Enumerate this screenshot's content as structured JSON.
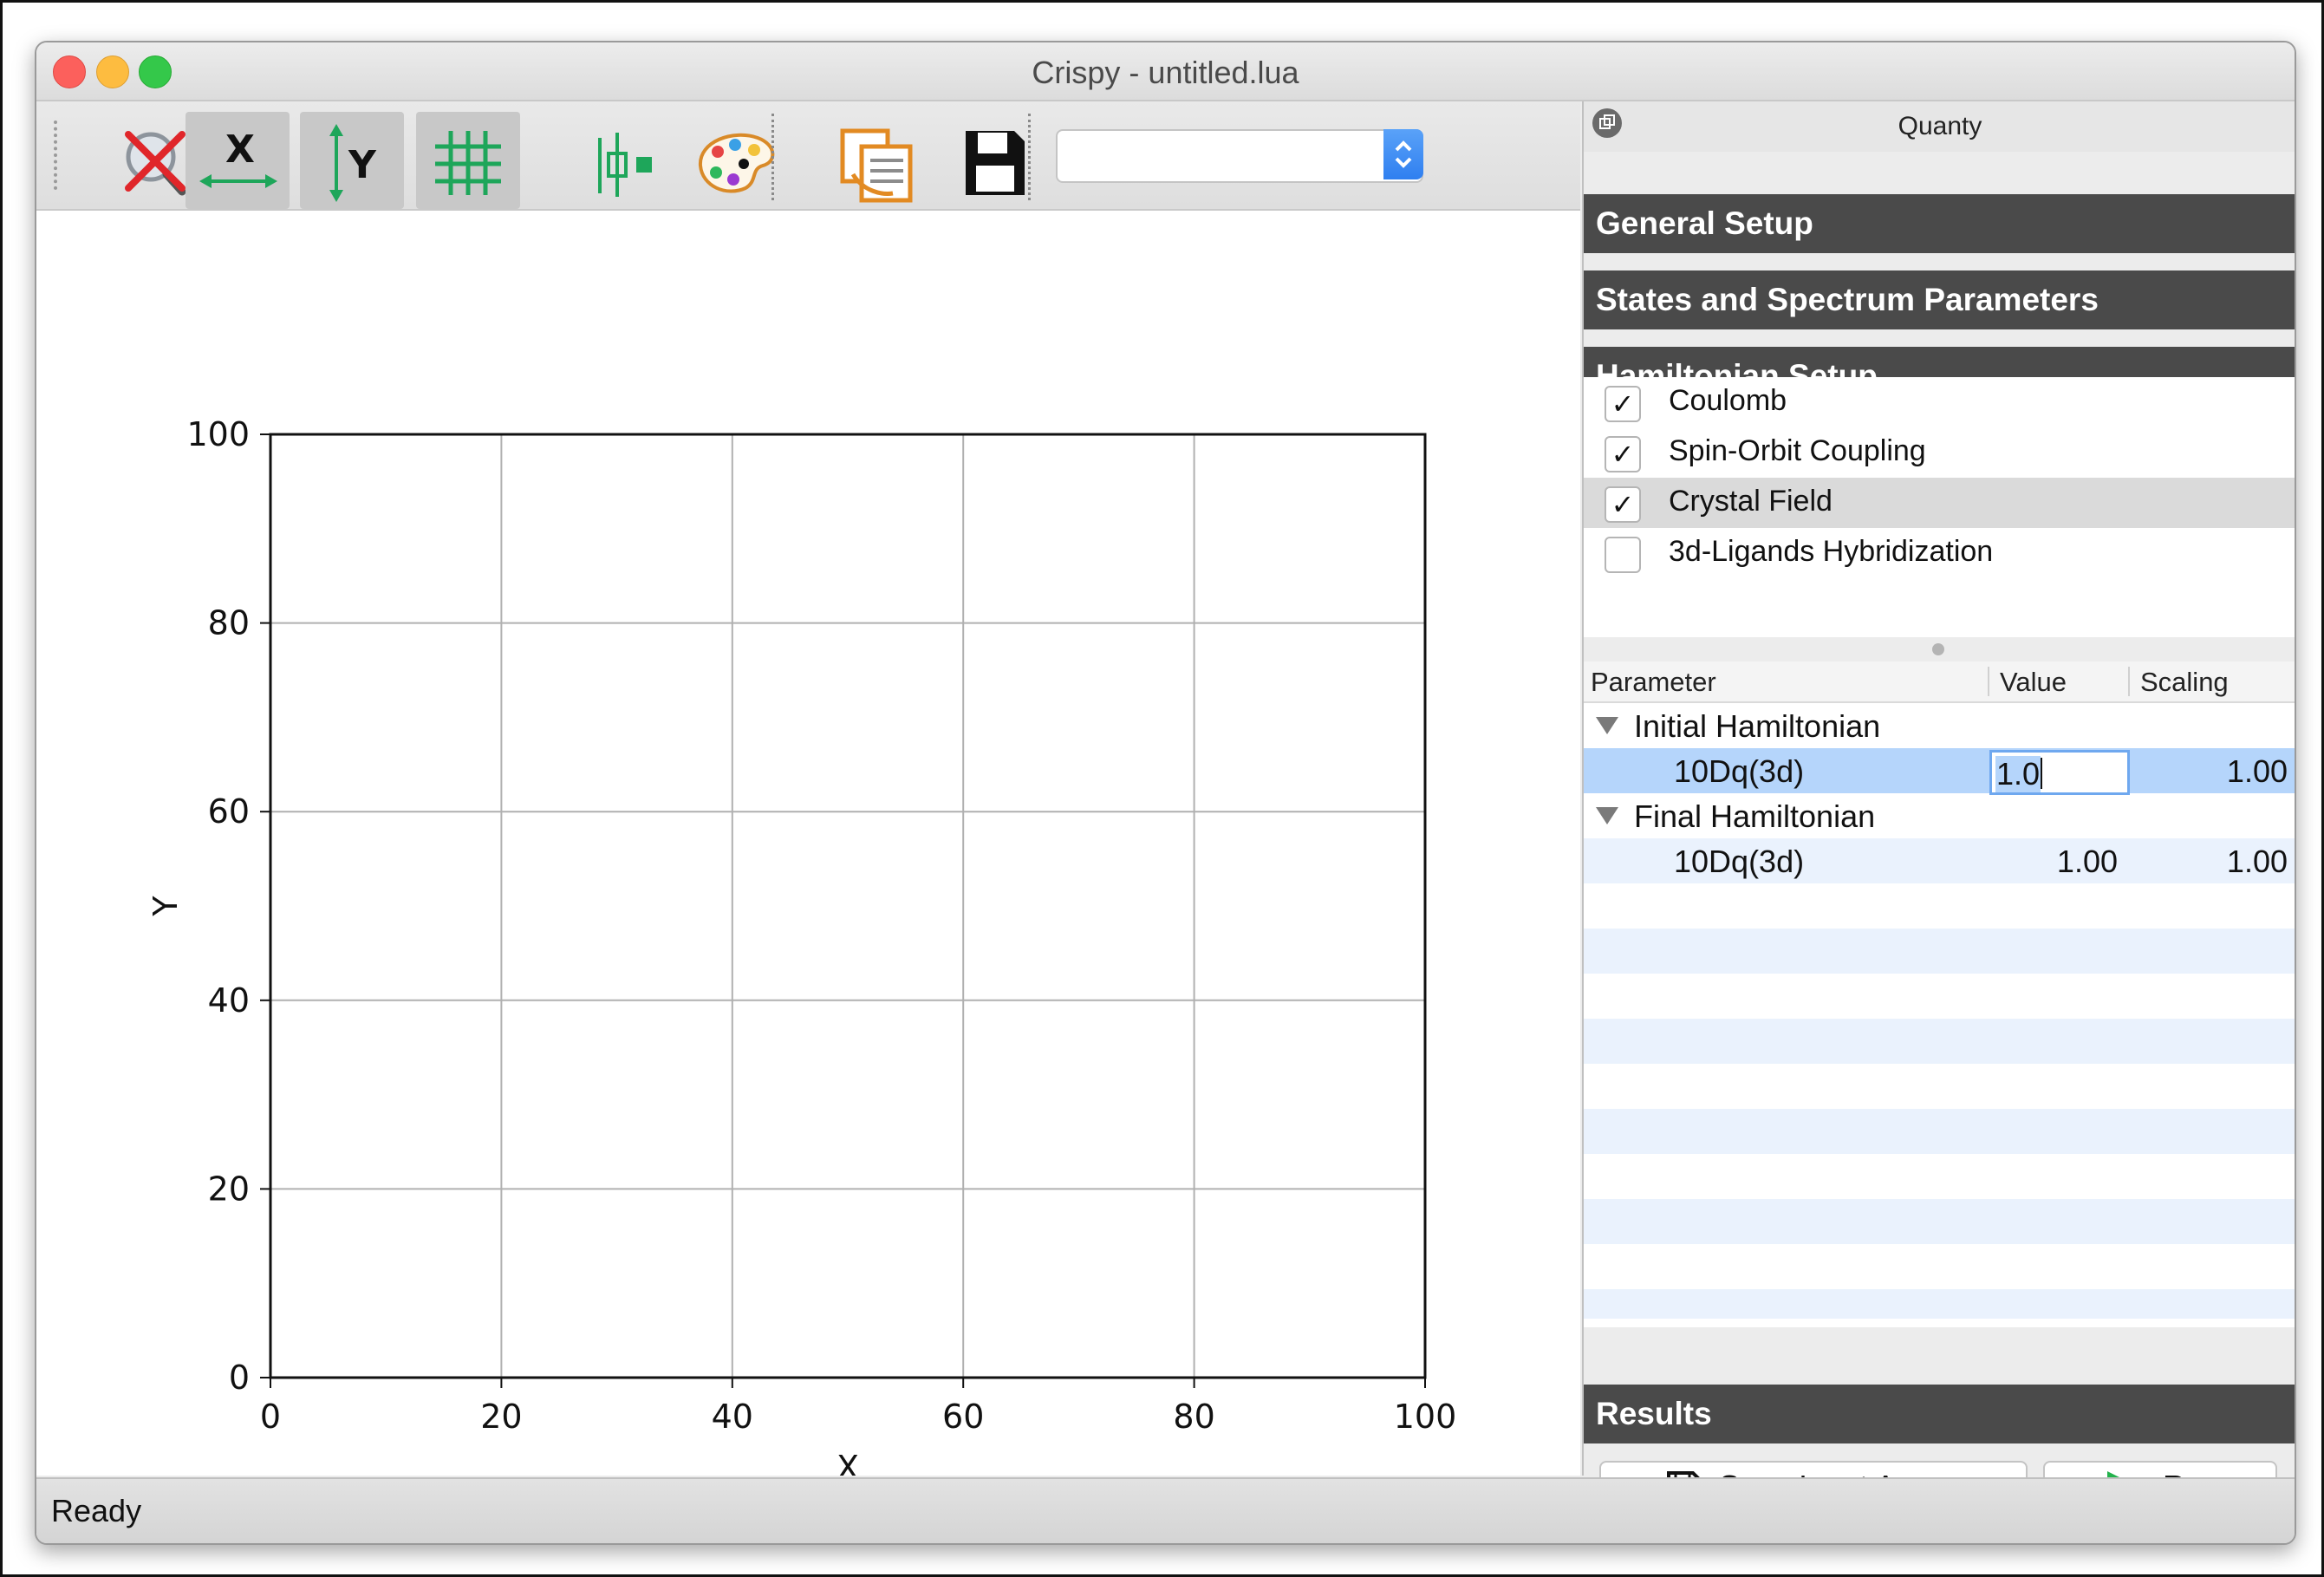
{
  "window": {
    "title": "Crispy - untitled.lua"
  },
  "toolbar": {
    "icons": [
      "zoom-reset-icon",
      "x-axis-icon",
      "y-axis-icon",
      "grid-icon",
      "curve-style-icon",
      "palette-icon",
      "copy-icon",
      "save-icon"
    ],
    "combo_value": ""
  },
  "chart_data": {
    "type": "line",
    "series": [],
    "xlabel": "X",
    "ylabel": "Y",
    "xlim": [
      0,
      100
    ],
    "ylim": [
      0,
      100
    ],
    "xticks": [
      "0",
      "20",
      "40",
      "60",
      "80",
      "100"
    ],
    "yticks": [
      "0",
      "20",
      "40",
      "60",
      "80",
      "100"
    ],
    "grid": true
  },
  "dock": {
    "title": "Quanty",
    "sections": {
      "general": "General Setup",
      "states": "States and Spectrum Parameters",
      "hamiltonian": "Hamiltonian Setup",
      "results": "Results"
    },
    "terms": [
      {
        "label": "Coulomb",
        "checked": true
      },
      {
        "label": "Spin-Orbit Coupling",
        "checked": true
      },
      {
        "label": "Crystal Field",
        "checked": true
      },
      {
        "label": "3d-Ligands Hybridization",
        "checked": false
      }
    ],
    "check_glyph": "✓",
    "table": {
      "headers": {
        "parameter": "Parameter",
        "value": "Value",
        "scaling": "Scaling"
      },
      "groups": [
        {
          "name": "Initial Hamiltonian",
          "rows": [
            {
              "parameter": "10Dq(3d)",
              "value": "1.0",
              "scaling": "1.00"
            }
          ]
        },
        {
          "name": "Final Hamiltonian",
          "rows": [
            {
              "parameter": "10Dq(3d)",
              "value": "1.00",
              "scaling": "1.00"
            }
          ]
        }
      ]
    },
    "buttons": {
      "save": "Save Input As...",
      "run": "Run"
    }
  },
  "status": {
    "text": "Ready"
  },
  "colors": {
    "section_bar": "#4a4a4a",
    "selection": "#b5d5fb",
    "stripe": "#eaf2fd",
    "accent_green": "#1ea65a",
    "run_green": "#22b24c"
  }
}
